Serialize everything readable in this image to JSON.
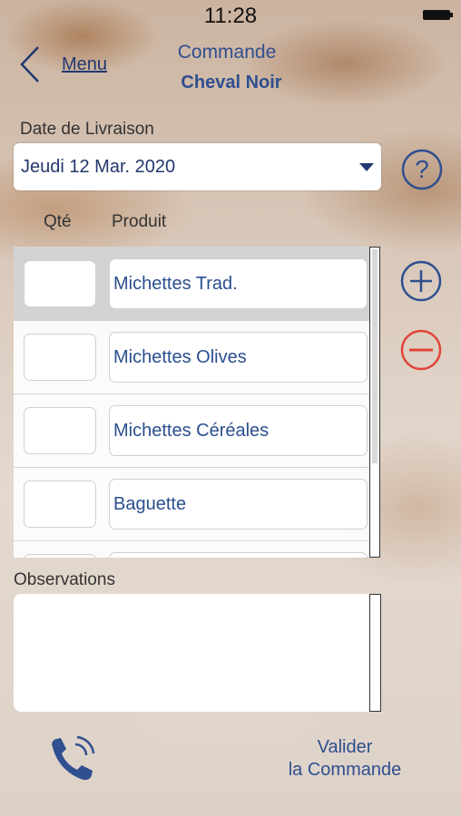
{
  "status_bar": {
    "time": "11:28"
  },
  "header": {
    "back_label": "Menu",
    "title_line1": "Commande",
    "title_line2": "Cheval Noir"
  },
  "delivery": {
    "label": "Date de Livraison",
    "value": "Jeudi 12 Mar. 2020"
  },
  "columns": {
    "qty": "Qté",
    "product": "Produit"
  },
  "products": [
    {
      "qty": "",
      "name": "Michettes Trad.",
      "selected": true
    },
    {
      "qty": "",
      "name": "Michettes Olives",
      "selected": false
    },
    {
      "qty": "",
      "name": "Michettes Céréales",
      "selected": false
    },
    {
      "qty": "",
      "name": "Baguette",
      "selected": false
    },
    {
      "qty": "",
      "name": "",
      "selected": false
    }
  ],
  "observations": {
    "label": "Observations",
    "value": ""
  },
  "footer": {
    "validate_line1": "Valider",
    "validate_line2": "la Commande"
  },
  "colors": {
    "accent": "#2f4f8f",
    "remove": "#e0453a",
    "text": "#333333"
  },
  "icons": {
    "back": "chevron-left-icon",
    "help": "question-circle-icon",
    "add": "plus-circle-icon",
    "remove": "minus-circle-icon",
    "phone": "phone-icon"
  }
}
